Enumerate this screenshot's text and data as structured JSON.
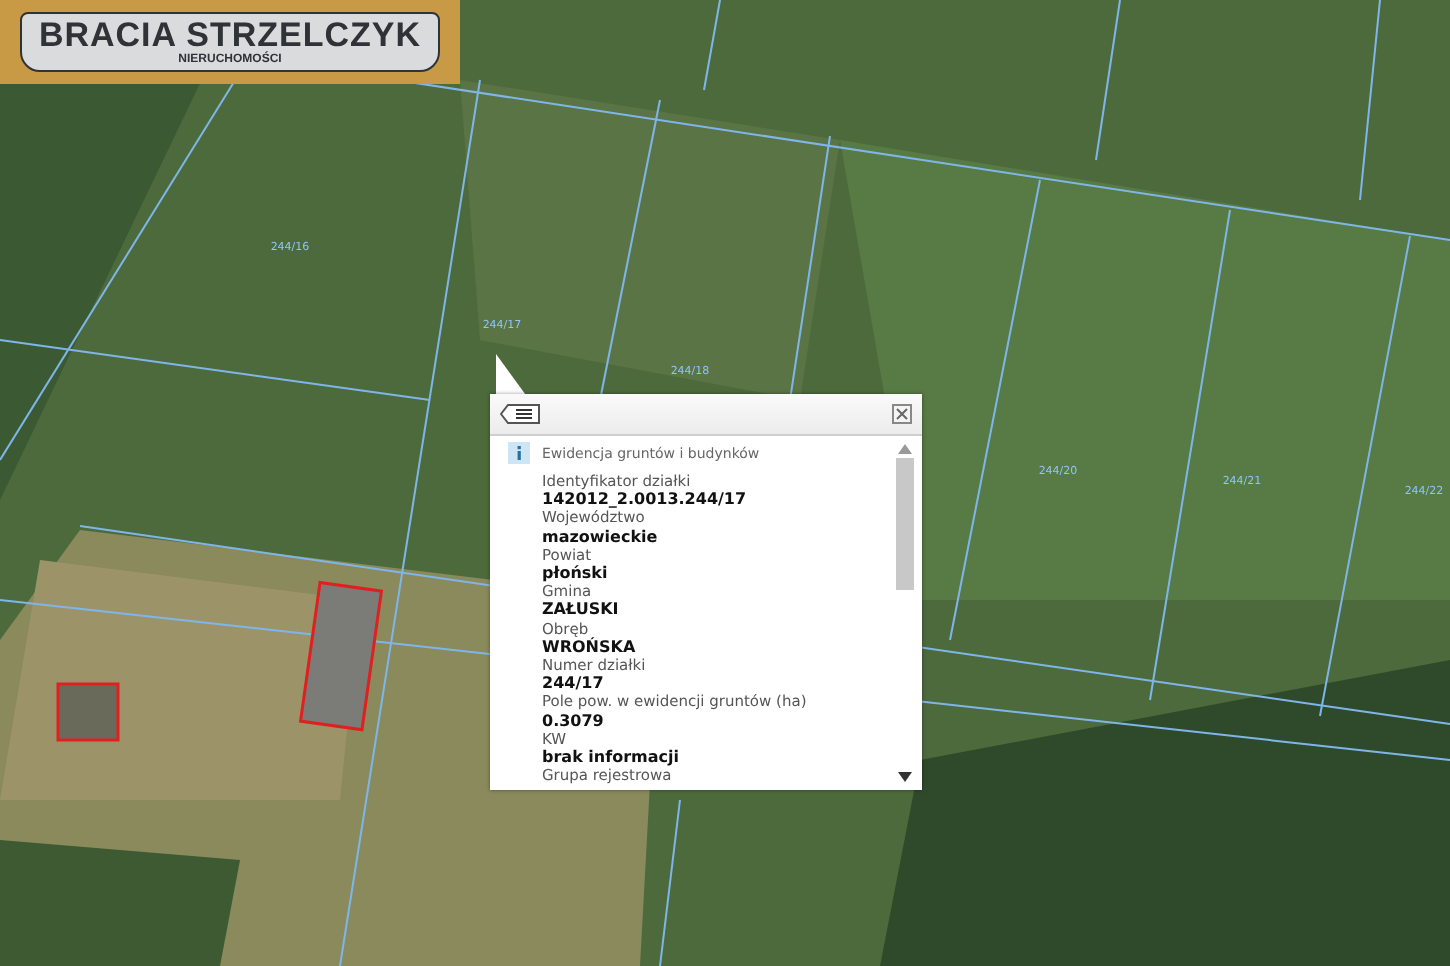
{
  "logo": {
    "title": "BRACIA STRZELCZYK",
    "subtitle": "NIERUCHOMOŚCI"
  },
  "map": {
    "parcel_labels": [
      "244/16",
      "244/17",
      "244/18",
      "244/20",
      "244/21",
      "244/22"
    ]
  },
  "popup": {
    "header": "Ewidencja gruntów i budynków",
    "fields": [
      {
        "label": "Identyfikator działki",
        "value": "142012_2.0013.244/17"
      },
      {
        "label": "Województwo",
        "value": "mazowieckie"
      },
      {
        "label": "Powiat",
        "value": "płoński"
      },
      {
        "label": "Gmina",
        "value": "ZAŁUSKI"
      },
      {
        "label": "Obręb",
        "value": "WROŃSKA"
      },
      {
        "label": "Numer działki",
        "value": "244/17"
      },
      {
        "label": "Pole pow. w ewidencji gruntów (ha)",
        "value": "0.3079"
      },
      {
        "label": "KW",
        "value": "brak informacji"
      },
      {
        "label": "Grupa rejestrowa"
      }
    ]
  }
}
